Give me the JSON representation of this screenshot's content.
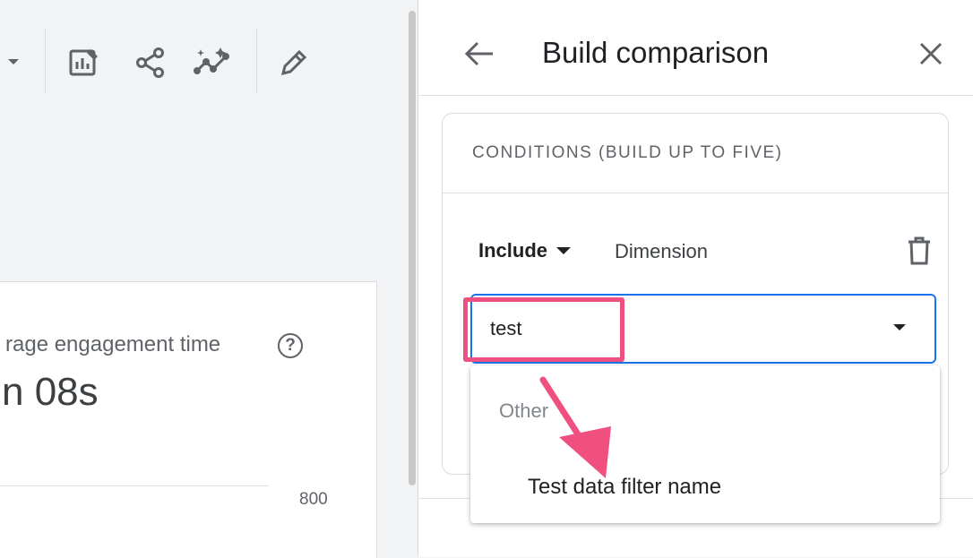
{
  "report": {
    "metric_label": "rage engagement time",
    "metric_value": "n 08s",
    "axis_tick": "800"
  },
  "toolbar": {
    "icons": [
      "chevron-down-icon",
      "edit-report-icon",
      "share-icon",
      "insights-icon",
      "pencil-icon"
    ]
  },
  "panel": {
    "title": "Build comparison",
    "conditions_title": "CONDITIONS (BUILD UP TO FIVE)",
    "include_label": "Include",
    "dimension_label": "Dimension",
    "select_value": "test",
    "dropdown": {
      "section_label": "Other",
      "items": [
        "Test data filter name"
      ]
    }
  },
  "colors": {
    "accent": "#1a73e8",
    "annotation": "#f0507f"
  }
}
